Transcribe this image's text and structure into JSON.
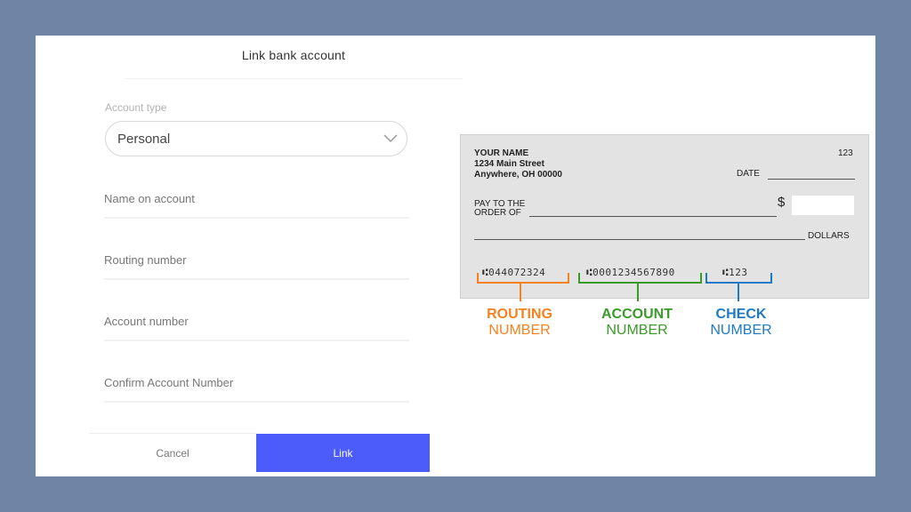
{
  "form": {
    "title": "Link bank account",
    "account_type_label": "Account type",
    "account_type_value": "Personal",
    "fields": [
      {
        "label": "Name on account"
      },
      {
        "label": "Routing number"
      },
      {
        "label": "Account number"
      },
      {
        "label": "Confirm Account Number"
      }
    ],
    "cancel_label": "Cancel",
    "link_label": "Link"
  },
  "check": {
    "name": "YOUR NAME",
    "address1": "1234 Main Street",
    "address2": "Anywhere, OH 00000",
    "check_no": "123",
    "date_label": "DATE",
    "pay_to_1": "PAY TO THE",
    "pay_to_2": "ORDER OF",
    "dollar_sign": "$",
    "dollars_label": "DOLLARS",
    "micr_routing": "⑆044072324",
    "micr_account": "⑆0001234567890",
    "micr_check": "⑆123"
  },
  "callouts": {
    "routing": {
      "line1": "ROUTING",
      "line2": "NUMBER",
      "color": "#f58220"
    },
    "account": {
      "line1": "ACCOUNT",
      "line2": "NUMBER",
      "color": "#3a9a2a"
    },
    "check": {
      "line1": "CHECK",
      "line2": "NUMBER",
      "color": "#1e7ac4"
    }
  },
  "colors": {
    "background": "#7085a5",
    "link_button": "#4b5cfb"
  }
}
